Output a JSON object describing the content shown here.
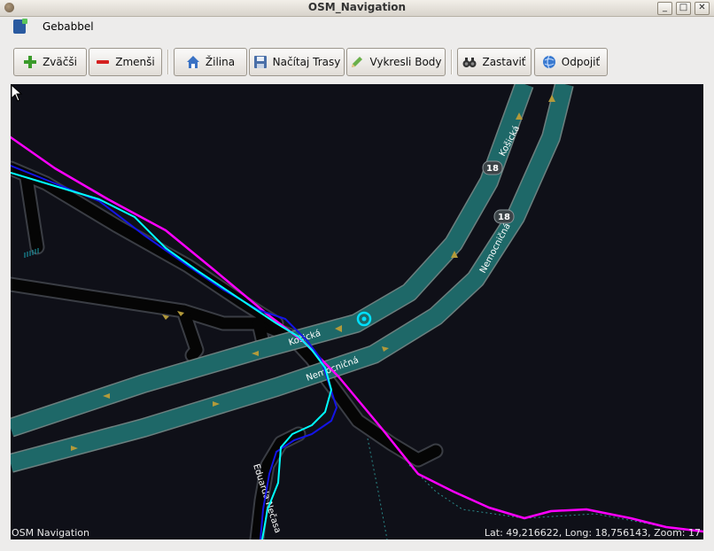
{
  "window": {
    "title": "OSM_Navigation",
    "minimize": "_",
    "maximize": "□",
    "close": "✕"
  },
  "menu": {
    "items": [
      "Gebabbel"
    ]
  },
  "toolbar": {
    "zoom_in": "Zväčši",
    "zoom_out": "Zmenši",
    "home": "Žilina",
    "load_routes": "Načítaj Trasy",
    "draw_points": "Vykresli Body",
    "stop": "Zastaviť",
    "disconnect": "Odpojiť"
  },
  "map": {
    "overlay_left": "OSM Navigation",
    "status": "Lat: 49,216622,  Long: 18,756143, Zoom: 17",
    "street_labels": [
      "Košická",
      "Nemocničná",
      "Košická",
      "Nemocničná",
      "Eduarda Nečasa"
    ],
    "road_shields": [
      "18",
      "18"
    ],
    "colors": {
      "background": "#0f1018",
      "main_road": "#1f6a6a",
      "minor_road": "#000000",
      "track_magenta": "#ff00ff",
      "track_cyan": "#00ffff",
      "track_blue": "#1414e6"
    }
  }
}
